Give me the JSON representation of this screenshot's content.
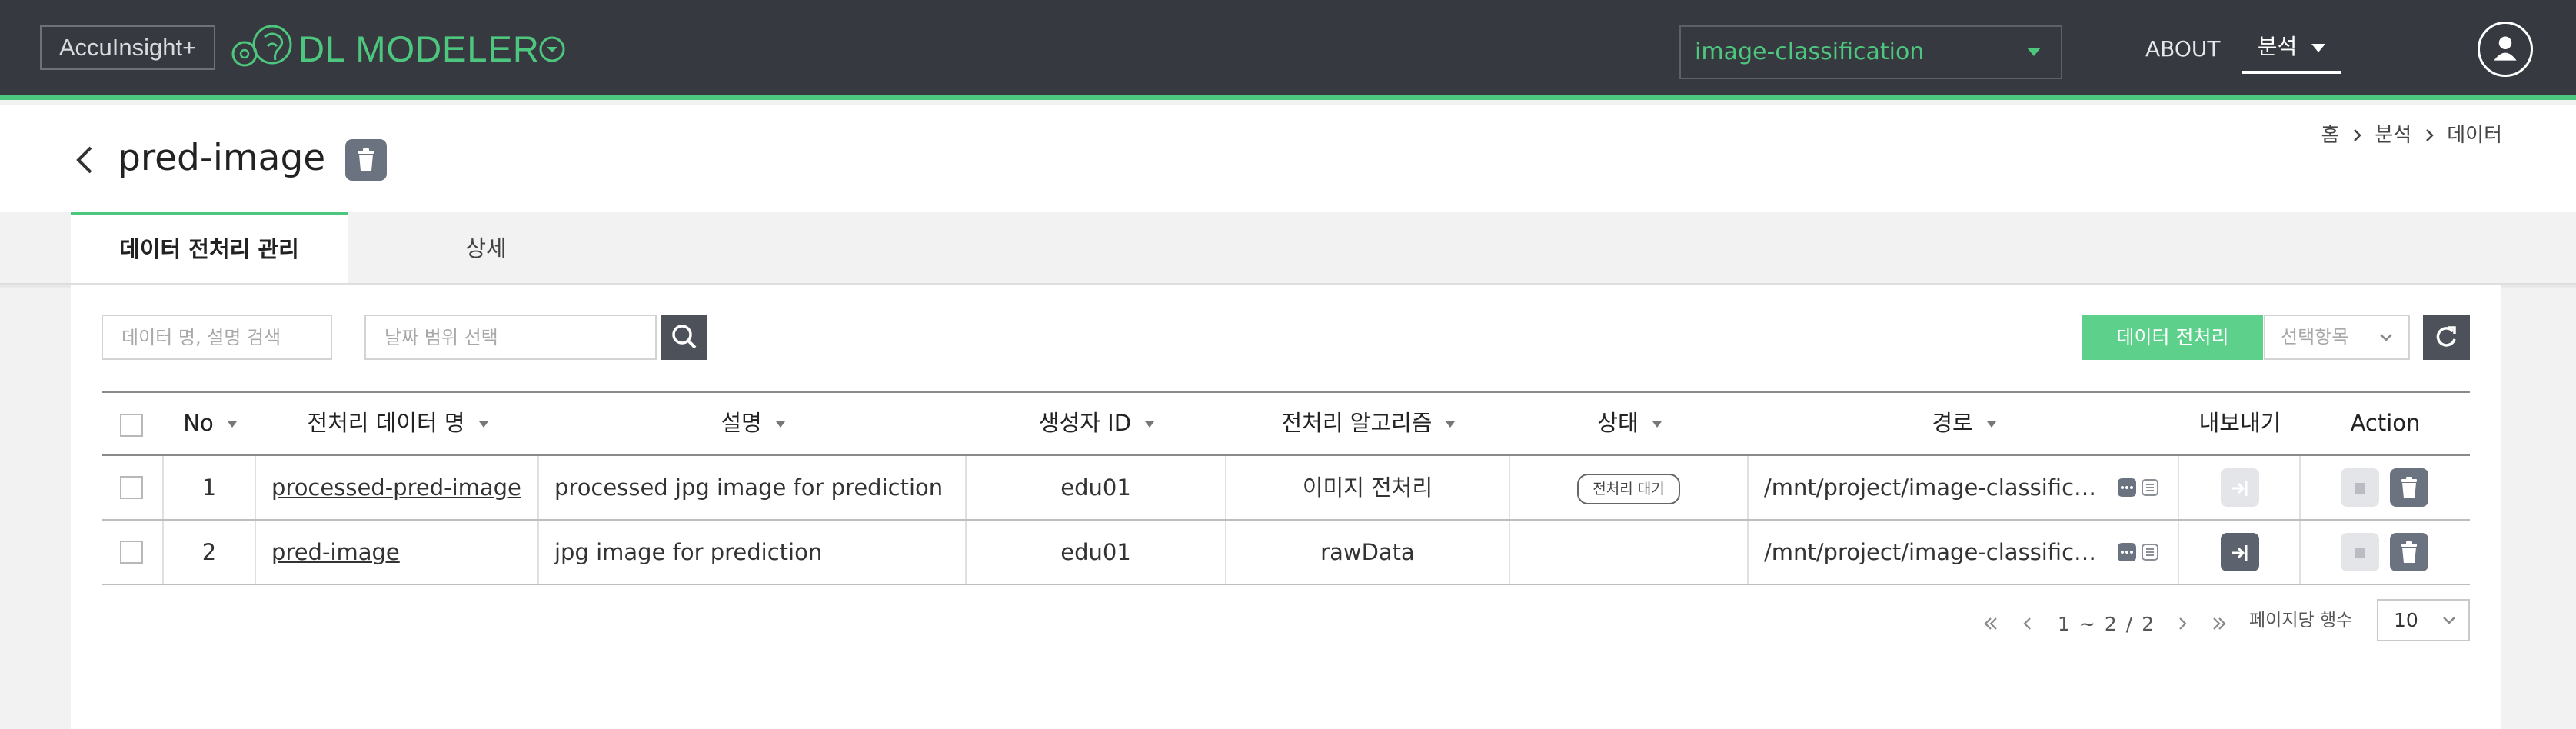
{
  "topbar": {
    "brand": "AccuInsight+",
    "app_title": "DL MODELER",
    "project": "image-classification",
    "nav_about": "ABOUT",
    "nav_analysis": "분석",
    "colors": {
      "bar": "#363a40",
      "accent": "#4ec77e"
    }
  },
  "page": {
    "title": "pred-image",
    "breadcrumb": [
      "홈",
      "분석",
      "데이터"
    ]
  },
  "tabs": [
    {
      "label": "데이터 전처리 관리",
      "active": true
    },
    {
      "label": "상세",
      "active": false
    }
  ],
  "toolbar": {
    "search_placeholder": "데이터 명, 설명 검색",
    "date_placeholder": "날짜 범위 선택",
    "preprocess_button": "데이터 전처리",
    "select_placeholder": "선택항목"
  },
  "table": {
    "columns": [
      "No",
      "전처리 데이터 명",
      "설명",
      "생성자 ID",
      "전처리 알고리즘",
      "상태",
      "경로",
      "내보내기",
      "Action"
    ],
    "rows": [
      {
        "no": "1",
        "name": "processed-pred-image",
        "desc": "processed jpg image for prediction",
        "creator": "edu01",
        "algorithm": "이미지 전처리",
        "status": "전처리 대기",
        "path": "/mnt/project/image-classification/data/processed-pred-image",
        "export_enabled": false
      },
      {
        "no": "2",
        "name": "pred-image",
        "desc": "jpg image for prediction",
        "creator": "edu01",
        "algorithm": "rawData",
        "status": "",
        "path": "/mnt/project/image-classification/data/pred-image",
        "export_enabled": true
      }
    ]
  },
  "pagination": {
    "current": "1",
    "tilde": "~",
    "page_end": "2",
    "slash": "/",
    "total": "2",
    "rows_label": "페이지당 행수",
    "rows_per_page": "10"
  }
}
